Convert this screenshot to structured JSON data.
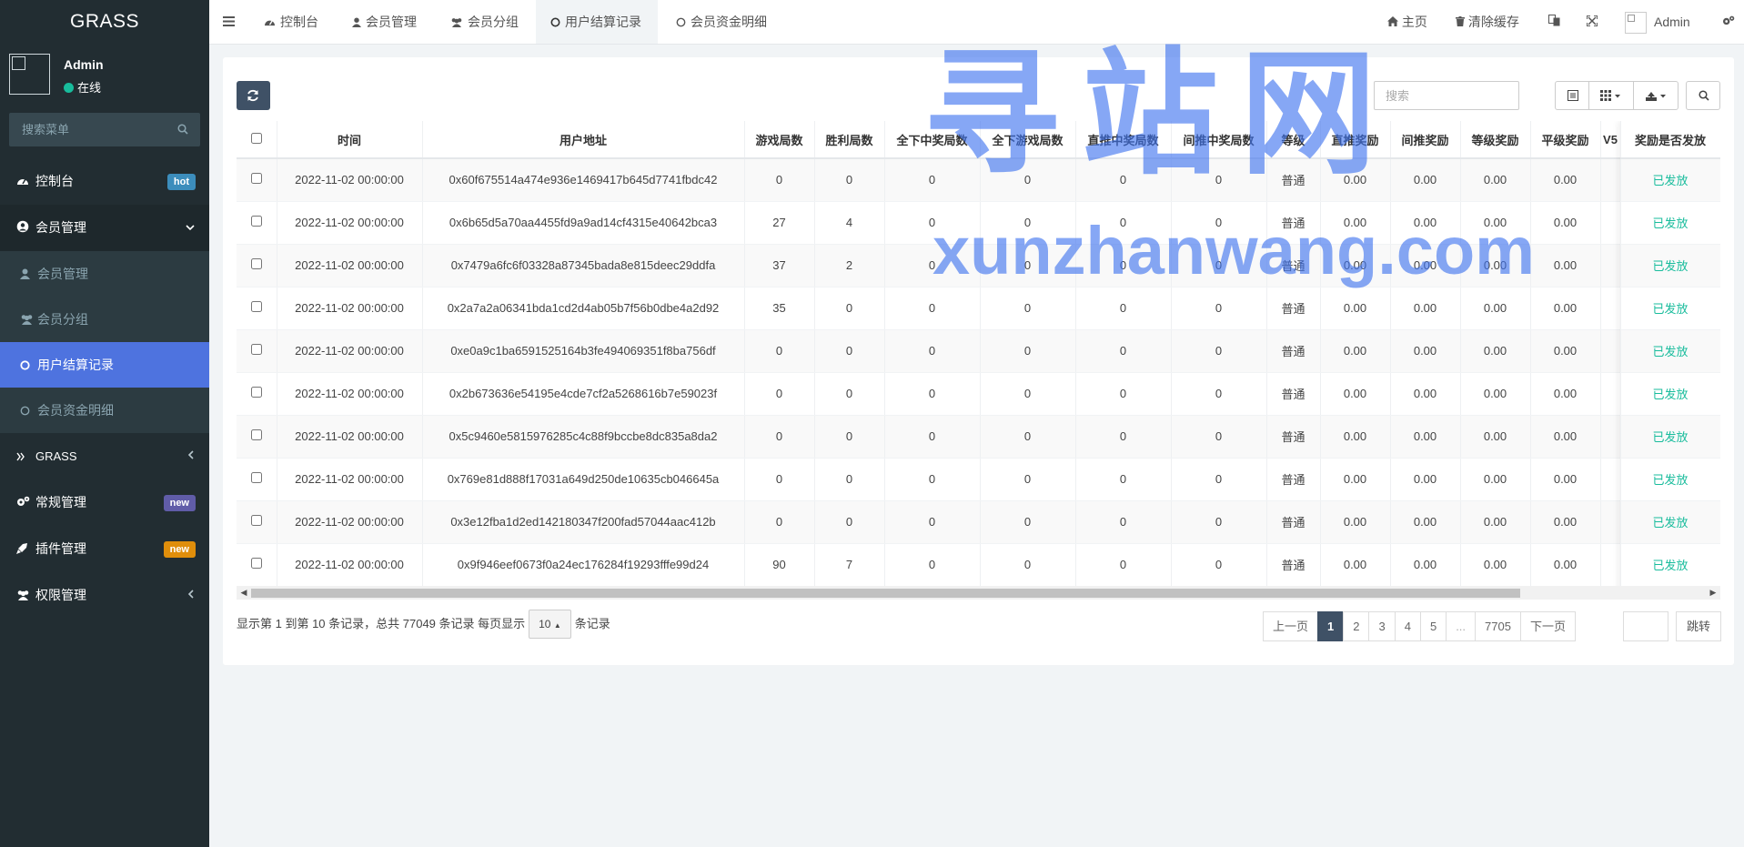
{
  "app": {
    "title": "GRASS"
  },
  "user": {
    "name": "Admin",
    "status": "在线"
  },
  "sidebar": {
    "search_placeholder": "搜索菜单",
    "items": [
      {
        "label": "控制台",
        "badge": "hot",
        "badge_color": "#3c8dbc"
      },
      {
        "label": "会员管理"
      },
      {
        "label": "GRASS"
      },
      {
        "label": "常规管理",
        "badge": "new",
        "badge_color": "#605ca8"
      },
      {
        "label": "插件管理",
        "badge": "new",
        "badge_color": "#e08e0b"
      },
      {
        "label": "权限管理"
      }
    ],
    "sub_items": [
      {
        "label": "会员管理"
      },
      {
        "label": "会员分组"
      },
      {
        "label": "用户结算记录"
      },
      {
        "label": "会员资金明细"
      }
    ]
  },
  "header": {
    "tabs": [
      {
        "label": "控制台"
      },
      {
        "label": "会员管理"
      },
      {
        "label": "会员分组"
      },
      {
        "label": "用户结算记录"
      },
      {
        "label": "会员资金明细"
      }
    ],
    "home_label": "主页",
    "clear_cache_label": "清除缓存",
    "admin_label": "Admin"
  },
  "toolbar": {
    "search_placeholder": "搜索"
  },
  "table": {
    "columns": [
      "时间",
      "用户地址",
      "游戏局数",
      "胜利局数",
      "全下中奖局数",
      "全下游戏局数",
      "直推中奖局数",
      "间推中奖局数",
      "等级",
      "直推奖励",
      "间推奖励",
      "等级奖励",
      "平级奖励",
      "V5",
      "奖励是否发放"
    ],
    "rows": [
      [
        "2022-11-02 00:00:00",
        "0x60f675514a474e936e1469417b645d7741fbdc42",
        "0",
        "0",
        "0",
        "0",
        "0",
        "0",
        "普通",
        "0.00",
        "0.00",
        "0.00",
        "0.00",
        "",
        "已发放"
      ],
      [
        "2022-11-02 00:00:00",
        "0x6b65d5a70aa4455fd9a9ad14cf4315e40642bca3",
        "27",
        "4",
        "0",
        "0",
        "0",
        "0",
        "普通",
        "0.00",
        "0.00",
        "0.00",
        "0.00",
        "",
        "已发放"
      ],
      [
        "2022-11-02 00:00:00",
        "0x7479a6fc6f03328a87345bada8e815deec29ddfa",
        "37",
        "2",
        "0",
        "0",
        "0",
        "0",
        "普通",
        "0.00",
        "0.00",
        "0.00",
        "0.00",
        "",
        "已发放"
      ],
      [
        "2022-11-02 00:00:00",
        "0x2a7a2a06341bda1cd2d4ab05b7f56b0dbe4a2d92",
        "35",
        "0",
        "0",
        "0",
        "0",
        "0",
        "普通",
        "0.00",
        "0.00",
        "0.00",
        "0.00",
        "",
        "已发放"
      ],
      [
        "2022-11-02 00:00:00",
        "0xe0a9c1ba6591525164b3fe494069351f8ba756df",
        "0",
        "0",
        "0",
        "0",
        "0",
        "0",
        "普通",
        "0.00",
        "0.00",
        "0.00",
        "0.00",
        "",
        "已发放"
      ],
      [
        "2022-11-02 00:00:00",
        "0x2b673636e54195e4cde7cf2a5268616b7e59023f",
        "0",
        "0",
        "0",
        "0",
        "0",
        "0",
        "普通",
        "0.00",
        "0.00",
        "0.00",
        "0.00",
        "",
        "已发放"
      ],
      [
        "2022-11-02 00:00:00",
        "0x5c9460e5815976285c4c88f9bccbe8dc835a8da2",
        "0",
        "0",
        "0",
        "0",
        "0",
        "0",
        "普通",
        "0.00",
        "0.00",
        "0.00",
        "0.00",
        "",
        "已发放"
      ],
      [
        "2022-11-02 00:00:00",
        "0x769e81d888f17031a649d250de10635cb046645a",
        "0",
        "0",
        "0",
        "0",
        "0",
        "0",
        "普通",
        "0.00",
        "0.00",
        "0.00",
        "0.00",
        "",
        "已发放"
      ],
      [
        "2022-11-02 00:00:00",
        "0x3e12fba1d2ed142180347f200fad57044aac412b",
        "0",
        "0",
        "0",
        "0",
        "0",
        "0",
        "普通",
        "0.00",
        "0.00",
        "0.00",
        "0.00",
        "",
        "已发放"
      ],
      [
        "2022-11-02 00:00:00",
        "0x9f946eef0673f0a24ec176284f19293fffe99d24",
        "90",
        "7",
        "0",
        "0",
        "0",
        "0",
        "普通",
        "0.00",
        "0.00",
        "0.00",
        "0.00",
        "",
        "已发放"
      ]
    ],
    "status_color": "#18bc9c"
  },
  "pagination": {
    "info_prefix": "显示第 1 到第 10 条记录，总共 77049 条记录 每页显示",
    "page_size": "10",
    "info_suffix": "条记录",
    "prev": "上一页",
    "pages": [
      "1",
      "2",
      "3",
      "4",
      "5",
      "...",
      "7705"
    ],
    "active_page": "1",
    "next": "下一页",
    "jump_label": "跳转"
  },
  "watermark": {
    "cn": "寻站网",
    "en": "xunzhanwang.com"
  }
}
